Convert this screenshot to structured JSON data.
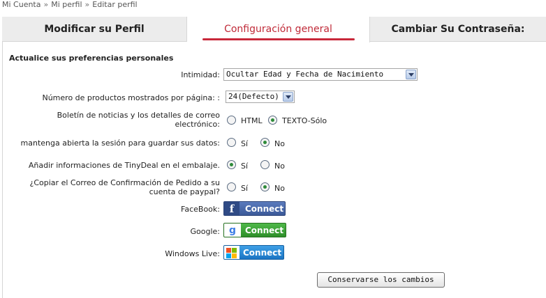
{
  "breadcrumb": {
    "items": [
      "Mi Cuenta",
      "Mi perfil",
      "Editar perfil"
    ],
    "separator": "»"
  },
  "tabs": [
    {
      "label": "Modificar su Perfil",
      "active": false
    },
    {
      "label": "Configuración general",
      "active": true
    },
    {
      "label": "Cambiar Su Contraseña:",
      "active": false
    }
  ],
  "section_title": "Actualice sus preferencias personales",
  "form": {
    "privacy": {
      "label": "Intimidad:",
      "value": "Ocultar Edad y Fecha de Nacimiento"
    },
    "products_per_page": {
      "label": "Número de productos mostrados por página: :",
      "value": "24(Defecto)"
    },
    "newsletter": {
      "label_line1": "Boletín de noticias y los detalles de correo",
      "label_line2": "electrónico:",
      "options": [
        "HTML",
        "TEXTO-Sólo"
      ],
      "selected": "TEXTO-Sólo"
    },
    "keep_session": {
      "label": "mantenga abierta la sesión para guardar sus datos:",
      "options": [
        "Sí",
        "No"
      ],
      "selected": "No"
    },
    "tinydeal_info": {
      "label": "Añadir informaciones de TinyDeal en el embalaje.",
      "options": [
        "Sí",
        "No"
      ],
      "selected": "Sí"
    },
    "paypal_copy": {
      "label_line1": "¿Copiar el Correo de Confirmación de Pedido a su",
      "label_line2": "cuenta de paypal?",
      "options": [
        "Sí",
        "No"
      ],
      "selected": "No"
    }
  },
  "social": {
    "facebook": {
      "label": "FaceBook:",
      "button": "Connect",
      "icon": "facebook-icon",
      "color": "#3b5998"
    },
    "google": {
      "label": "Google:",
      "button": "Connect",
      "icon": "google-icon",
      "color": "#2e8f2a"
    },
    "windows_live": {
      "label": "Windows Live:",
      "button": "Connect",
      "icon": "windows-icon",
      "color": "#1b75c4"
    }
  },
  "save_button": "Conservarse los cambios",
  "colors": {
    "accent": "#c8283a",
    "tab_bg": "#ececec"
  }
}
